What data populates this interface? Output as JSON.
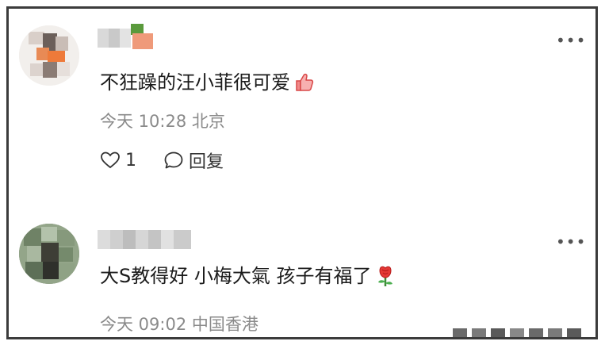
{
  "comments": [
    {
      "username": "",
      "text": "不狂躁的汪小菲很可爱",
      "emoji_icon": "thumbs-up-icon",
      "meta": "今天 10:28 北京",
      "like_count": "1",
      "reply_label": "回复"
    },
    {
      "username": "",
      "text": "大S教得好 小梅大氣 孩子有福了",
      "emoji_icon": "rose-icon",
      "meta": "今天 09:02 中国香港"
    }
  ],
  "colors": {
    "border": "#3b3b3b",
    "meta_text": "#8a8a8a",
    "body_text": "#1b1b1b"
  }
}
